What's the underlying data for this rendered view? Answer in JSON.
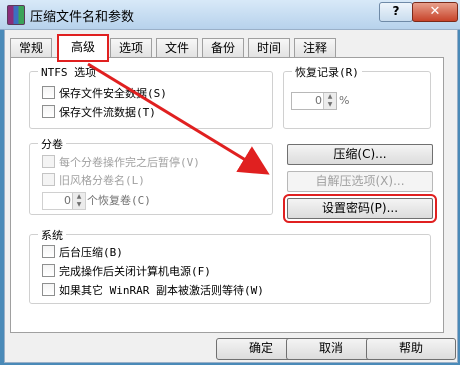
{
  "window": {
    "title": "压缩文件名和参数",
    "help_glyph": "?",
    "close_glyph": "✕"
  },
  "tabs": [
    {
      "label": "常规"
    },
    {
      "label": "高级"
    },
    {
      "label": "选项"
    },
    {
      "label": "文件"
    },
    {
      "label": "备份"
    },
    {
      "label": "时间"
    },
    {
      "label": "注释"
    }
  ],
  "active_tab": "高级",
  "ntfs": {
    "title": "NTFS 选项",
    "items": [
      {
        "label": "保存文件安全数据(S)",
        "checked": false
      },
      {
        "label": "保存文件流数据(T)",
        "checked": false
      }
    ]
  },
  "recovery": {
    "title": "恢复记录(R)",
    "value": "0",
    "unit": "%"
  },
  "volume": {
    "title": "分卷",
    "items": [
      {
        "label": "每个分卷操作完之后暂停(V)",
        "checked": false,
        "disabled": true
      },
      {
        "label": "旧风格分卷名(L)",
        "checked": false,
        "disabled": true
      }
    ],
    "recovery_volumes_value": "0",
    "recovery_volumes_label": "个恢复卷(C)"
  },
  "actions": {
    "compression": "压缩(C)...",
    "sfx_options": "自解压选项(X)...",
    "set_password": "设置密码(P)..."
  },
  "system": {
    "title": "系统",
    "items": [
      {
        "label": "后台压缩(B)",
        "checked": false
      },
      {
        "label": "完成操作后关闭计算机电源(F)",
        "checked": false
      },
      {
        "label": "如果其它 WinRAR 副本被激活则等待(W)",
        "checked": false
      }
    ]
  },
  "footer": {
    "ok": "确定",
    "cancel": "取消",
    "help": "帮助"
  },
  "colors": {
    "annotation_red": "#e02020"
  }
}
